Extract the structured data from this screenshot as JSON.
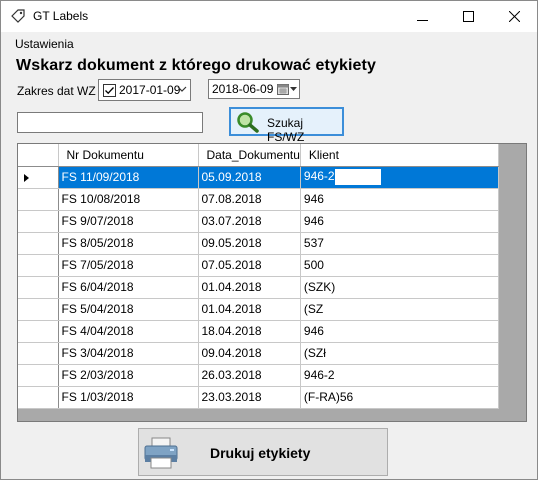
{
  "window": {
    "title": "GT Labels"
  },
  "menu": {
    "items": [
      {
        "label": "Ustawienia"
      }
    ]
  },
  "heading": "Wskarz dokument z którego drukować etykiety",
  "filters": {
    "range_label": "Zakres dat WZ",
    "date_from": "2017-01-09",
    "date_from_checked": true,
    "date_to": "2018-06-09",
    "search_value": "",
    "search_button_label": "Szukaj FS/WZ"
  },
  "grid": {
    "columns": [
      "Nr Dokumentu",
      "Data_Dokumentu",
      "Klient"
    ],
    "selected_row": 0,
    "rows": [
      {
        "nr": "FS 11/09/2018",
        "date": "05.09.2018",
        "client": "946-2"
      },
      {
        "nr": "FS 10/08/2018",
        "date": "07.08.2018",
        "client": "946"
      },
      {
        "nr": "FS 9/07/2018",
        "date": "03.07.2018",
        "client": "946"
      },
      {
        "nr": "FS 8/05/2018",
        "date": "09.05.2018",
        "client": "537"
      },
      {
        "nr": "FS 7/05/2018",
        "date": "07.05.2018",
        "client": "500"
      },
      {
        "nr": "FS 6/04/2018",
        "date": "01.04.2018",
        "client": "(SZK)"
      },
      {
        "nr": "FS 5/04/2018",
        "date": "01.04.2018",
        "client": "(SZ"
      },
      {
        "nr": "FS 4/04/2018",
        "date": "18.04.2018",
        "client": "946"
      },
      {
        "nr": "FS 3/04/2018",
        "date": "09.04.2018",
        "client": "(SZł"
      },
      {
        "nr": "FS 2/03/2018",
        "date": "26.03.2018",
        "client": "946-2"
      },
      {
        "nr": "FS 1/03/2018",
        "date": "23.03.2018",
        "client": "(F-RA)56"
      }
    ]
  },
  "print_button_label": "Drukuj etykiety",
  "colors": {
    "selection": "#0078d7",
    "search_button_border": "#3c8ed9"
  }
}
